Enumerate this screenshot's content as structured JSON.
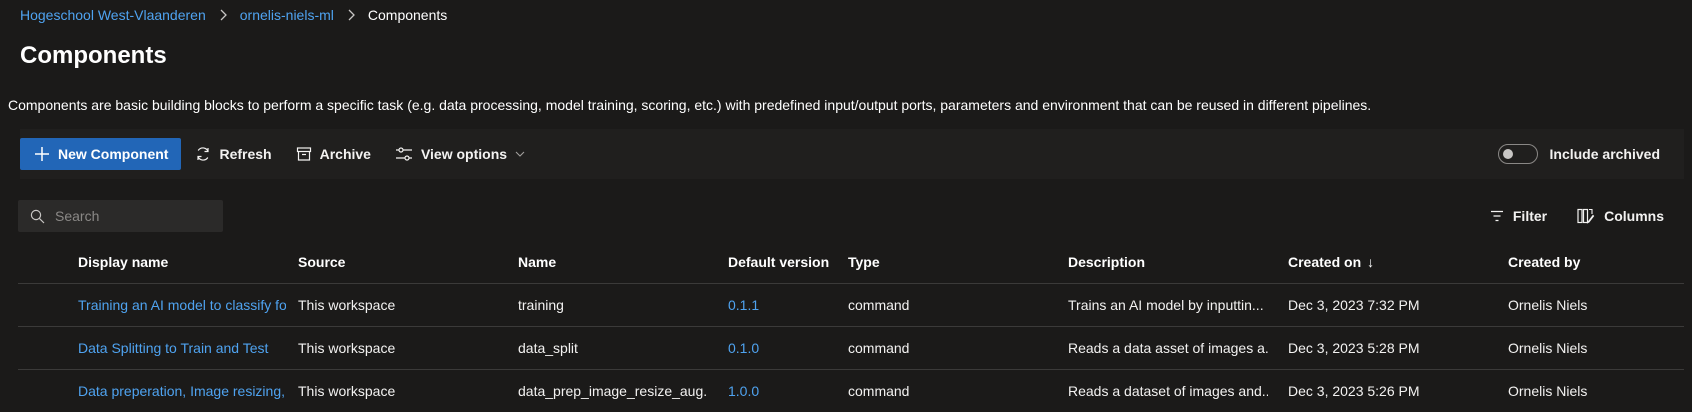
{
  "breadcrumb": {
    "items": [
      "Hogeschool West-Vlaanderen",
      "ornelis-niels-ml"
    ],
    "current": "Components"
  },
  "page": {
    "title": "Components",
    "description": "Components are basic building blocks to perform a specific task (e.g. data processing, model training, scoring, etc.) with predefined input/output ports, parameters and environment that can be reused in different pipelines."
  },
  "toolbar": {
    "new_component": "New Component",
    "refresh": "Refresh",
    "archive": "Archive",
    "view_options": "View options",
    "include_archived": "Include archived"
  },
  "search": {
    "placeholder": "Search"
  },
  "grid_actions": {
    "filter": "Filter",
    "columns": "Columns"
  },
  "table": {
    "headers": {
      "display_name": "Display name",
      "source": "Source",
      "name": "Name",
      "default_version": "Default version",
      "type": "Type",
      "description": "Description",
      "created_on": "Created on",
      "sort_indicator": "↓",
      "created_by": "Created by"
    },
    "rows": [
      {
        "display_name": "Training an AI model to classify fo",
        "source": "This workspace",
        "name": "training",
        "default_version": "0.1.1",
        "type": "command",
        "description": "Trains an AI model by inputtin...",
        "created_on": "Dec 3, 2023 7:32 PM",
        "created_by": "Ornelis Niels"
      },
      {
        "display_name": "Data Splitting to Train and Test",
        "source": "This workspace",
        "name": "data_split",
        "default_version": "0.1.0",
        "type": "command",
        "description": "Reads a data asset of images a...",
        "created_on": "Dec 3, 2023 5:28 PM",
        "created_by": "Ornelis Niels"
      },
      {
        "display_name": "Data preperation, Image resizing,",
        "source": "This workspace",
        "name": "data_prep_image_resize_aug...",
        "default_version": "1.0.0",
        "type": "command",
        "description": "Reads a dataset of images and...",
        "created_on": "Dec 3, 2023 5:26 PM",
        "created_by": "Ornelis Niels"
      }
    ]
  },
  "colors": {
    "accent": "#2266b7",
    "link": "#4fa3f0",
    "background": "#1b1a19"
  }
}
